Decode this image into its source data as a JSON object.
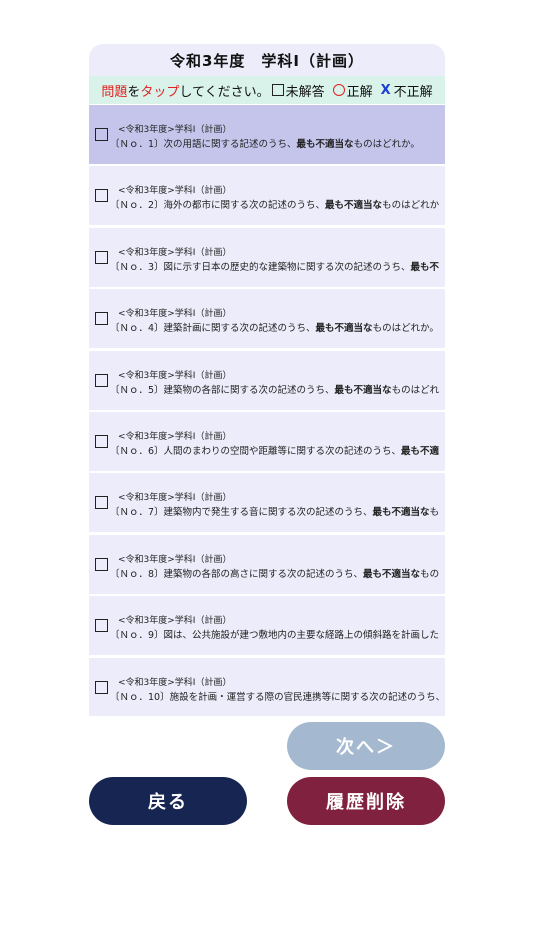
{
  "header": {
    "title": "令和3年度　学科Ⅰ（計画）"
  },
  "instruction": {
    "part1_red": "問題",
    "part2": "を",
    "part3_red": "タップ",
    "part4": "してください。",
    "unanswered_label": "未解答",
    "correct_label": "正解",
    "incorrect_mark": "X",
    "incorrect_label": "不正解"
  },
  "questions": [
    {
      "category": "<令和3年度>学科Ⅰ（計画）",
      "prefix": "〔Ｎｏ．1〕次の用語に関する記述のうち、",
      "emphasis": "最も不適当な",
      "suffix": "ものはどれか。",
      "selected": true
    },
    {
      "category": "<令和3年度>学科Ⅰ（計画）",
      "prefix": "〔Ｎｏ．2〕海外の都市に関する次の記述のうち、",
      "emphasis": "最も不適当な",
      "suffix": "ものはどれか",
      "selected": false
    },
    {
      "category": "<令和3年度>学科Ⅰ（計画）",
      "prefix": "〔Ｎｏ．3〕図に示す日本の歴史的な建築物に関する次の記述のうち、",
      "emphasis": "最も不",
      "suffix": "",
      "selected": false
    },
    {
      "category": "<令和3年度>学科Ⅰ（計画）",
      "prefix": "〔Ｎｏ．4〕建築計画に関する次の記述のうち、",
      "emphasis": "最も不適当な",
      "suffix": "ものはどれか。",
      "selected": false
    },
    {
      "category": "<令和3年度>学科Ⅰ（計画）",
      "prefix": "〔Ｎｏ．5〕建築物の各部に関する次の記述のうち、",
      "emphasis": "最も不適当な",
      "suffix": "ものはどれ",
      "selected": false
    },
    {
      "category": "<令和3年度>学科Ⅰ（計画）",
      "prefix": "〔Ｎｏ．6〕人間のまわりの空間や距離等に関する次の記述のうち、",
      "emphasis": "最も不適",
      "suffix": "",
      "selected": false
    },
    {
      "category": "<令和3年度>学科Ⅰ（計画）",
      "prefix": "〔Ｎｏ．7〕建築物内で発生する音に関する次の記述のうち、",
      "emphasis": "最も不適当な",
      "suffix": "も",
      "selected": false
    },
    {
      "category": "<令和3年度>学科Ⅰ（計画）",
      "prefix": "〔Ｎｏ．8〕建築物の各部の高さに関する次の記述のうち、",
      "emphasis": "最も不適当な",
      "suffix": "もの",
      "selected": false
    },
    {
      "category": "<令和3年度>学科Ⅰ（計画）",
      "prefix": "〔Ｎｏ．9〕図は、公共施設が建つ敷地内の主要な経路上の傾斜路を計画した",
      "emphasis": "",
      "suffix": "",
      "selected": false
    },
    {
      "category": "<令和3年度>学科Ⅰ（計画）",
      "prefix": "〔Ｎｏ．10〕施設を計画・運営する際の官民連携等に関する次の記述のうち、",
      "emphasis": "",
      "suffix": "",
      "selected": false
    }
  ],
  "buttons": {
    "next_label": "次へ＞",
    "back_label": "戻る",
    "delete_label": "履歴削除"
  },
  "colors": {
    "title_bg": "#ececfa",
    "instruction_bg": "#daf3ea",
    "row_bg": "#ececfa",
    "row_selected_bg": "#c5c5ec",
    "next_button": "#a4b9cf",
    "back_button": "#172552",
    "delete_button": "#80223f",
    "accent_red": "#e02020",
    "accent_blue": "#1a3fd1"
  }
}
